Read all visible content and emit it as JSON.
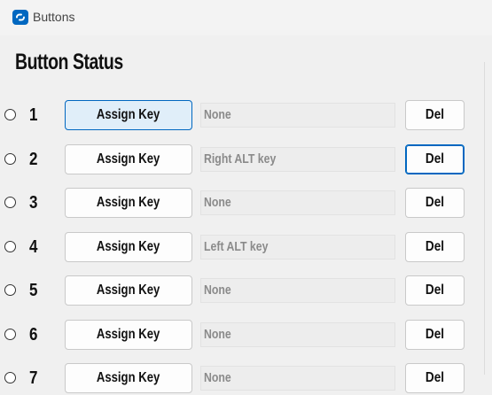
{
  "window": {
    "title": "Buttons",
    "icon": "app-logo-icon",
    "accent": "#0067c0"
  },
  "section": {
    "title": "Button Status"
  },
  "assign_label": "Assign Key",
  "del_label": "Del",
  "rows": [
    {
      "num": "1",
      "key": "None",
      "assign_state": "hover",
      "del_state": "normal"
    },
    {
      "num": "2",
      "key": "Right ALT key",
      "assign_state": "normal",
      "del_state": "focused"
    },
    {
      "num": "3",
      "key": "None",
      "assign_state": "normal",
      "del_state": "normal"
    },
    {
      "num": "4",
      "key": "Left ALT key",
      "assign_state": "normal",
      "del_state": "normal"
    },
    {
      "num": "5",
      "key": "None",
      "assign_state": "normal",
      "del_state": "normal"
    },
    {
      "num": "6",
      "key": "None",
      "assign_state": "normal",
      "del_state": "normal"
    },
    {
      "num": "7",
      "key": "None",
      "assign_state": "normal",
      "del_state": "normal"
    }
  ]
}
